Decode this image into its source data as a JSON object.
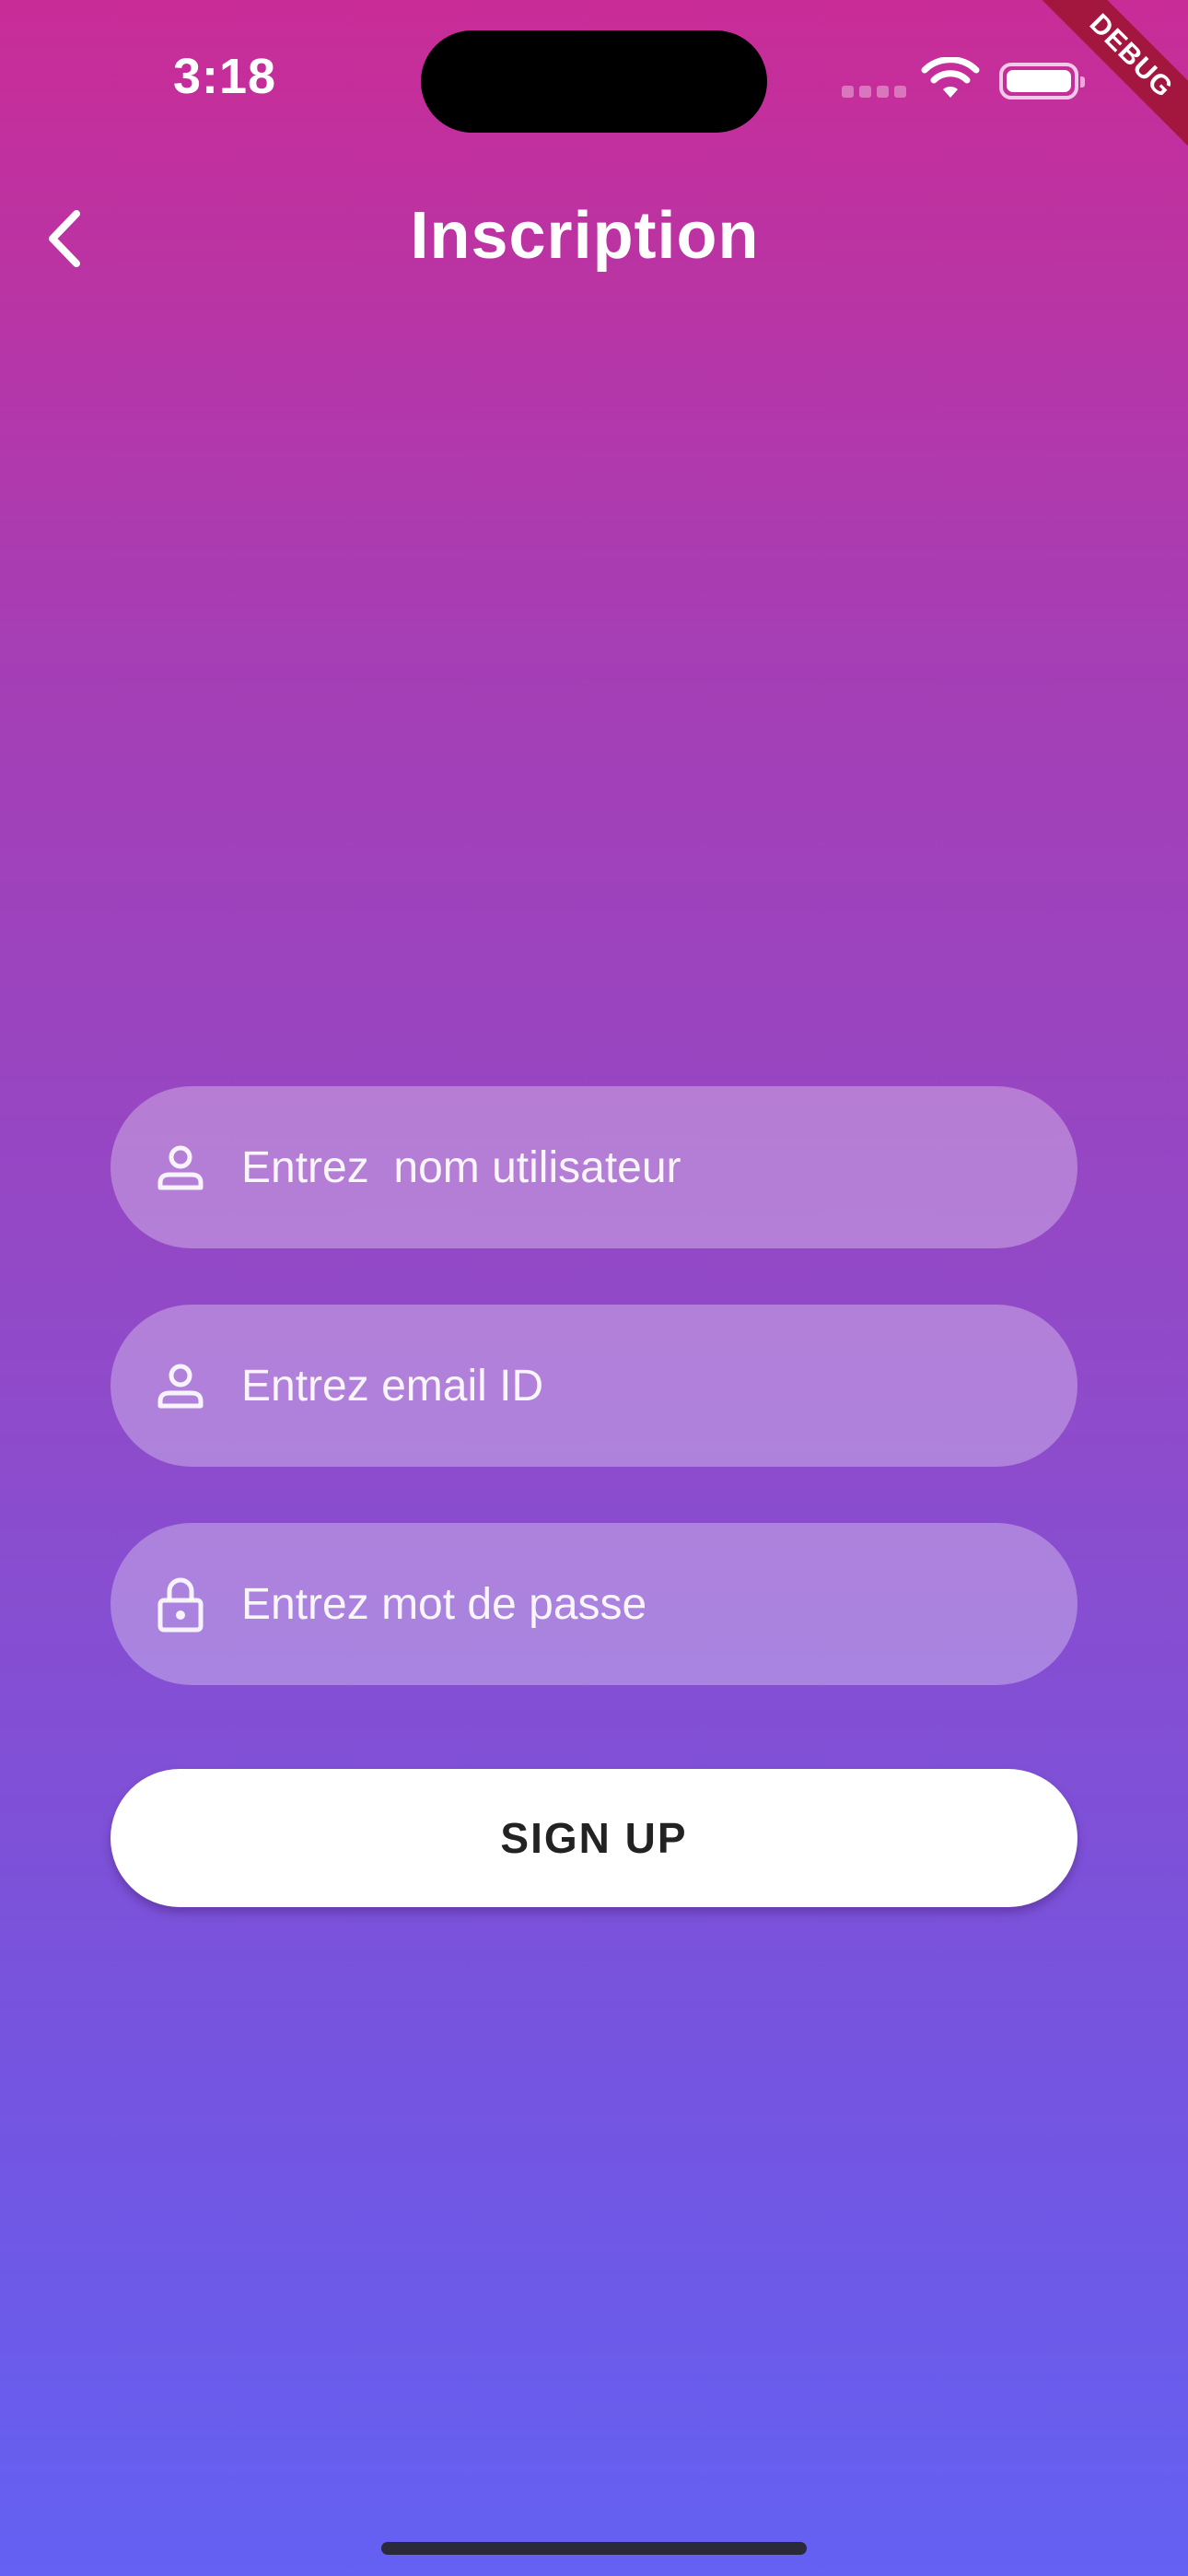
{
  "status_bar": {
    "time": "3:18"
  },
  "debug_banner": {
    "label": "DEBUG"
  },
  "app_bar": {
    "title": "Inscription",
    "back_icon": "chevron-left-icon"
  },
  "form": {
    "username": {
      "placeholder": "Entrez  nom utilisateur",
      "value": "",
      "icon": "person-icon"
    },
    "email": {
      "placeholder": "Entrez email ID",
      "value": "",
      "icon": "person-icon"
    },
    "password": {
      "placeholder": "Entrez mot de passe",
      "value": "",
      "icon": "lock-icon"
    },
    "submit_label": "SIGN UP"
  },
  "colors": {
    "gradient_top": "#C92C97",
    "gradient_bottom": "#6461F3",
    "button_bg": "#FFFFFF",
    "debug_banner": "#A3163E"
  }
}
